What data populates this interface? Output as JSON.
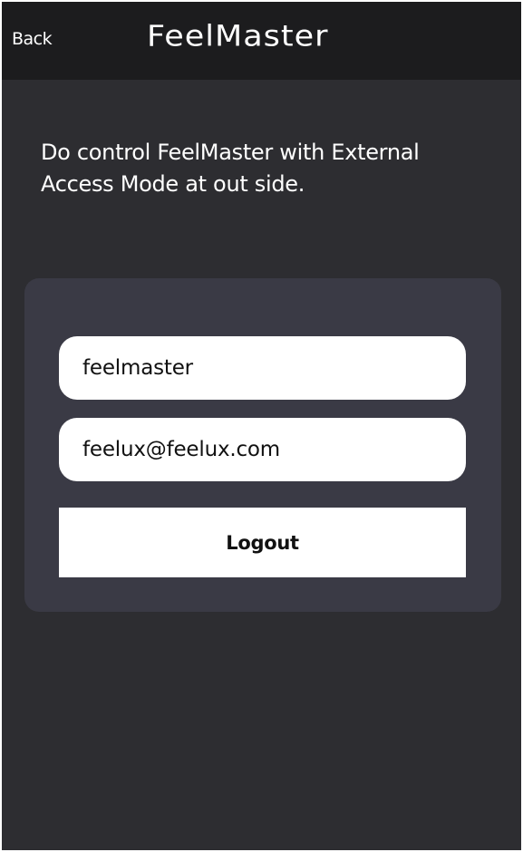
{
  "header": {
    "back_label": "Back",
    "title": "FeelMaster"
  },
  "description": "Do control FeelMaster with External Access Mode at out side.",
  "account": {
    "username": "feelmaster",
    "email": "feelux@feelux.com",
    "logout_label": "Logout"
  },
  "colors": {
    "background": "#2d2d31",
    "header": "#1c1c1e",
    "card": "#3a3a45",
    "field": "#ffffff",
    "text_light": "#ffffff",
    "text_dark": "#111111"
  }
}
